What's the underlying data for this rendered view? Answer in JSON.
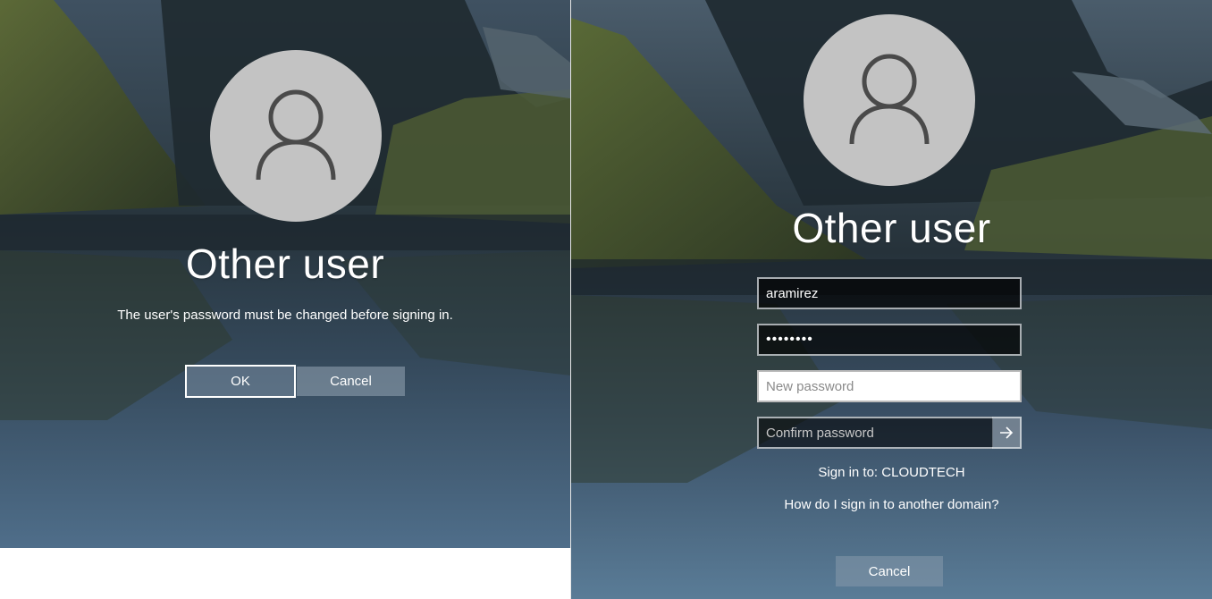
{
  "left_screen": {
    "username": "Other user",
    "message": "The user's password must be changed before signing in.",
    "ok_label": "OK",
    "cancel_label": "Cancel"
  },
  "right_screen": {
    "username": "Other user",
    "username_value": "aramirez",
    "password_value": "••••••••",
    "new_password_placeholder": "New password",
    "confirm_password_placeholder": "Confirm password",
    "sign_in_to": "Sign in to: CLOUDTECH",
    "other_domain_link": "How do I sign in to another domain?",
    "cancel_label": "Cancel"
  },
  "icons": {
    "avatar": "user-silhouette-icon",
    "submit": "arrow-right-icon"
  },
  "colors": {
    "avatar_bg": "#c3c3c3",
    "avatar_stroke": "#4a4a4a",
    "field_bg": "#000000",
    "active_field_bg": "#ffffff"
  }
}
